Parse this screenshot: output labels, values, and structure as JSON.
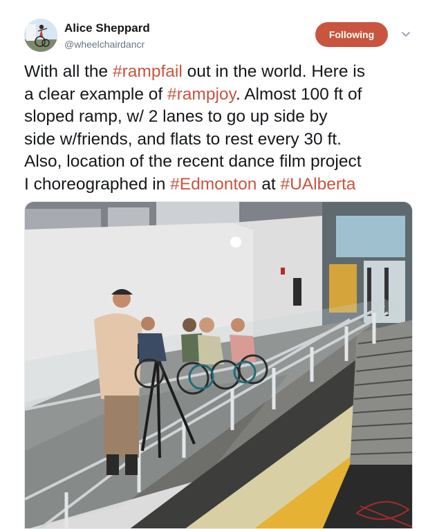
{
  "author": {
    "name": "Alice Sheppard",
    "handle": "@wheelchairdancr",
    "avatar_icon": "profile-photo-dancer-icon"
  },
  "follow_button": {
    "label": "Following",
    "color": "#c9553f"
  },
  "menu": {
    "icon": "chevron-down-icon"
  },
  "tweet": {
    "lines": [
      [
        {
          "t": "With all the "
        },
        {
          "t": "#rampfail",
          "tag": true
        },
        {
          "t": " out in the world. Here is"
        }
      ],
      [
        {
          "t": "a clear example of "
        },
        {
          "t": "#rampjoy",
          "tag": true
        },
        {
          "t": ". Almost 100 ft of"
        }
      ],
      [
        {
          "t": "sloped ramp, w/ 2 lanes to go up side by"
        }
      ],
      [
        {
          "t": "side w/friends, and flats to rest every 30 ft."
        }
      ],
      [
        {
          "t": "Also, location of the recent dance film project"
        }
      ],
      [
        {
          "t": "I choreographed in "
        },
        {
          "t": "#Edmonton",
          "tag": true
        },
        {
          "t": " at "
        },
        {
          "t": "#UAlberta",
          "tag": true
        }
      ]
    ],
    "hashtag_color": "#c9553f"
  },
  "media": {
    "icon": "photo-ramp-dancers-icon"
  }
}
